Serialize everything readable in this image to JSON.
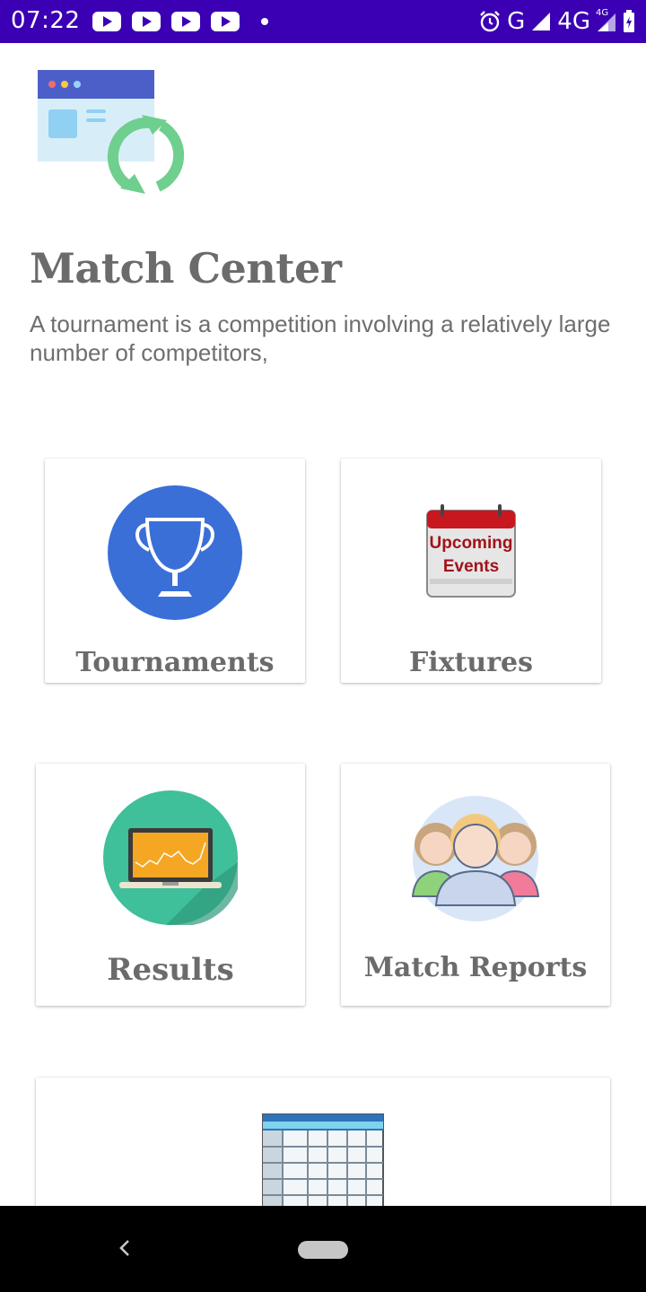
{
  "status_bar": {
    "time": "07:22",
    "network_label": "G",
    "network_4g": "4G",
    "network_4g_small": "4G",
    "notification_icons": [
      "youtube-icon",
      "youtube-icon",
      "youtube-icon",
      "youtube-icon"
    ],
    "background": "#3b00b3"
  },
  "header": {
    "title": "Match Center",
    "description": "A tournament is a competition involving a relatively large number of competitors,"
  },
  "menu": {
    "tournaments": {
      "label": "Tournaments",
      "icon": "trophy-icon"
    },
    "fixtures": {
      "label": "Fixtures",
      "icon": "calendar-icon",
      "icon_text_line1": "Upcoming",
      "icon_text_line2": "Events"
    },
    "results": {
      "label": "Results",
      "icon": "laptop-chart-icon"
    },
    "match_reports": {
      "label": "Match Reports",
      "icon": "people-icon"
    },
    "fifth": {
      "icon": "table-icon"
    }
  },
  "colors": {
    "accent": "#3b00b3",
    "trophy_bg": "#3a6fd8",
    "results_bg": "#3fbf9a",
    "calendar_red": "#c8171e"
  }
}
